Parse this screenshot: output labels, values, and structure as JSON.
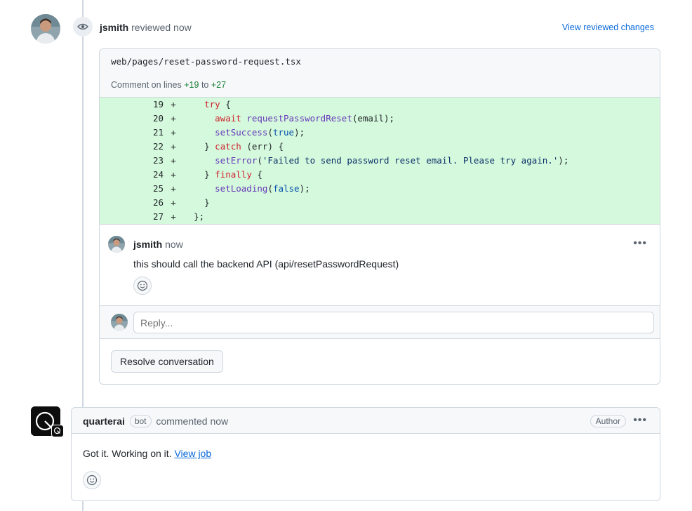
{
  "review": {
    "author": "jsmith",
    "action": "reviewed",
    "time": "now",
    "view_changes_label": "View reviewed changes"
  },
  "file": {
    "path": "web/pages/reset-password-request.tsx",
    "comment_prefix": "Comment on lines",
    "line_start": "+19",
    "line_to": "to",
    "line_end": "+27"
  },
  "diff_lines": [
    {
      "num": "19",
      "sign": "+"
    },
    {
      "num": "20",
      "sign": "+"
    },
    {
      "num": "21",
      "sign": "+"
    },
    {
      "num": "22",
      "sign": "+"
    },
    {
      "num": "23",
      "sign": "+"
    },
    {
      "num": "24",
      "sign": "+"
    },
    {
      "num": "25",
      "sign": "+"
    },
    {
      "num": "26",
      "sign": "+"
    },
    {
      "num": "27",
      "sign": "+"
    }
  ],
  "code": {
    "l19_indent": "    ",
    "l19_kw": "try",
    "l19_rest": " {",
    "l20_indent": "      ",
    "l20_kw": "await",
    "l20_sp": " ",
    "l20_fn": "requestPasswordReset",
    "l20_rest": "(email);",
    "l21_indent": "      ",
    "l21_fn": "setSuccess",
    "l21_open": "(",
    "l21_lit": "true",
    "l21_rest": ");",
    "l22_indent": "    ",
    "l22_pre": "} ",
    "l22_kw": "catch",
    "l22_rest": " (err) {",
    "l23_indent": "      ",
    "l23_fn": "setError",
    "l23_open": "(",
    "l23_str": "'Failed to send password reset email. Please try again.'",
    "l23_rest": ");",
    "l24_indent": "    ",
    "l24_pre": "} ",
    "l24_kw": "finally",
    "l24_rest": " {",
    "l25_indent": "      ",
    "l25_fn": "setLoading",
    "l25_open": "(",
    "l25_lit": "false",
    "l25_rest": ");",
    "l26_text": "    }",
    "l27_text": "  };"
  },
  "thread_comment": {
    "author": "jsmith",
    "time": "now",
    "body": "this should call the backend API (api/resetPasswordRequest)",
    "kebab": "•••"
  },
  "reply": {
    "placeholder": "Reply..."
  },
  "resolve_label": "Resolve conversation",
  "bot_comment": {
    "author": "quarterai",
    "bot_label": "bot",
    "action": "commented",
    "time": "now",
    "author_label": "Author",
    "kebab": "•••",
    "body_text": "Got it. Working on it.",
    "link_text": "View job"
  },
  "icons": {
    "eye": "eye-icon",
    "smiley": "smiley-icon",
    "kebab": "kebab-horizontal-icon"
  }
}
